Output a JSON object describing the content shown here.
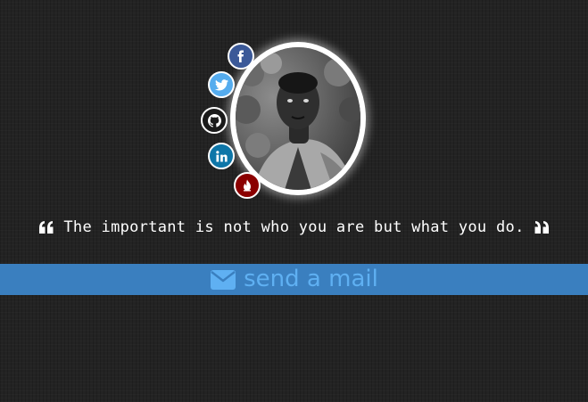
{
  "profile": {
    "avatar": "profile-photo"
  },
  "social_links": [
    {
      "name": "facebook",
      "icon": "facebook-icon",
      "color": "#3b5998"
    },
    {
      "name": "twitter",
      "icon": "twitter-icon",
      "color": "#55acee"
    },
    {
      "name": "github",
      "icon": "github-icon",
      "color": "#1a1a1a"
    },
    {
      "name": "linkedin",
      "icon": "linkedin-icon",
      "color": "#0e76a8"
    },
    {
      "name": "flame",
      "icon": "flame-icon",
      "color": "#8b0000"
    }
  ],
  "quote": {
    "text": "The important is not who you are but what you do."
  },
  "contact": {
    "label": "send a mail",
    "icon": "envelope-icon",
    "bar_color": "#3a7fbf",
    "text_color": "#5fb0f2"
  }
}
